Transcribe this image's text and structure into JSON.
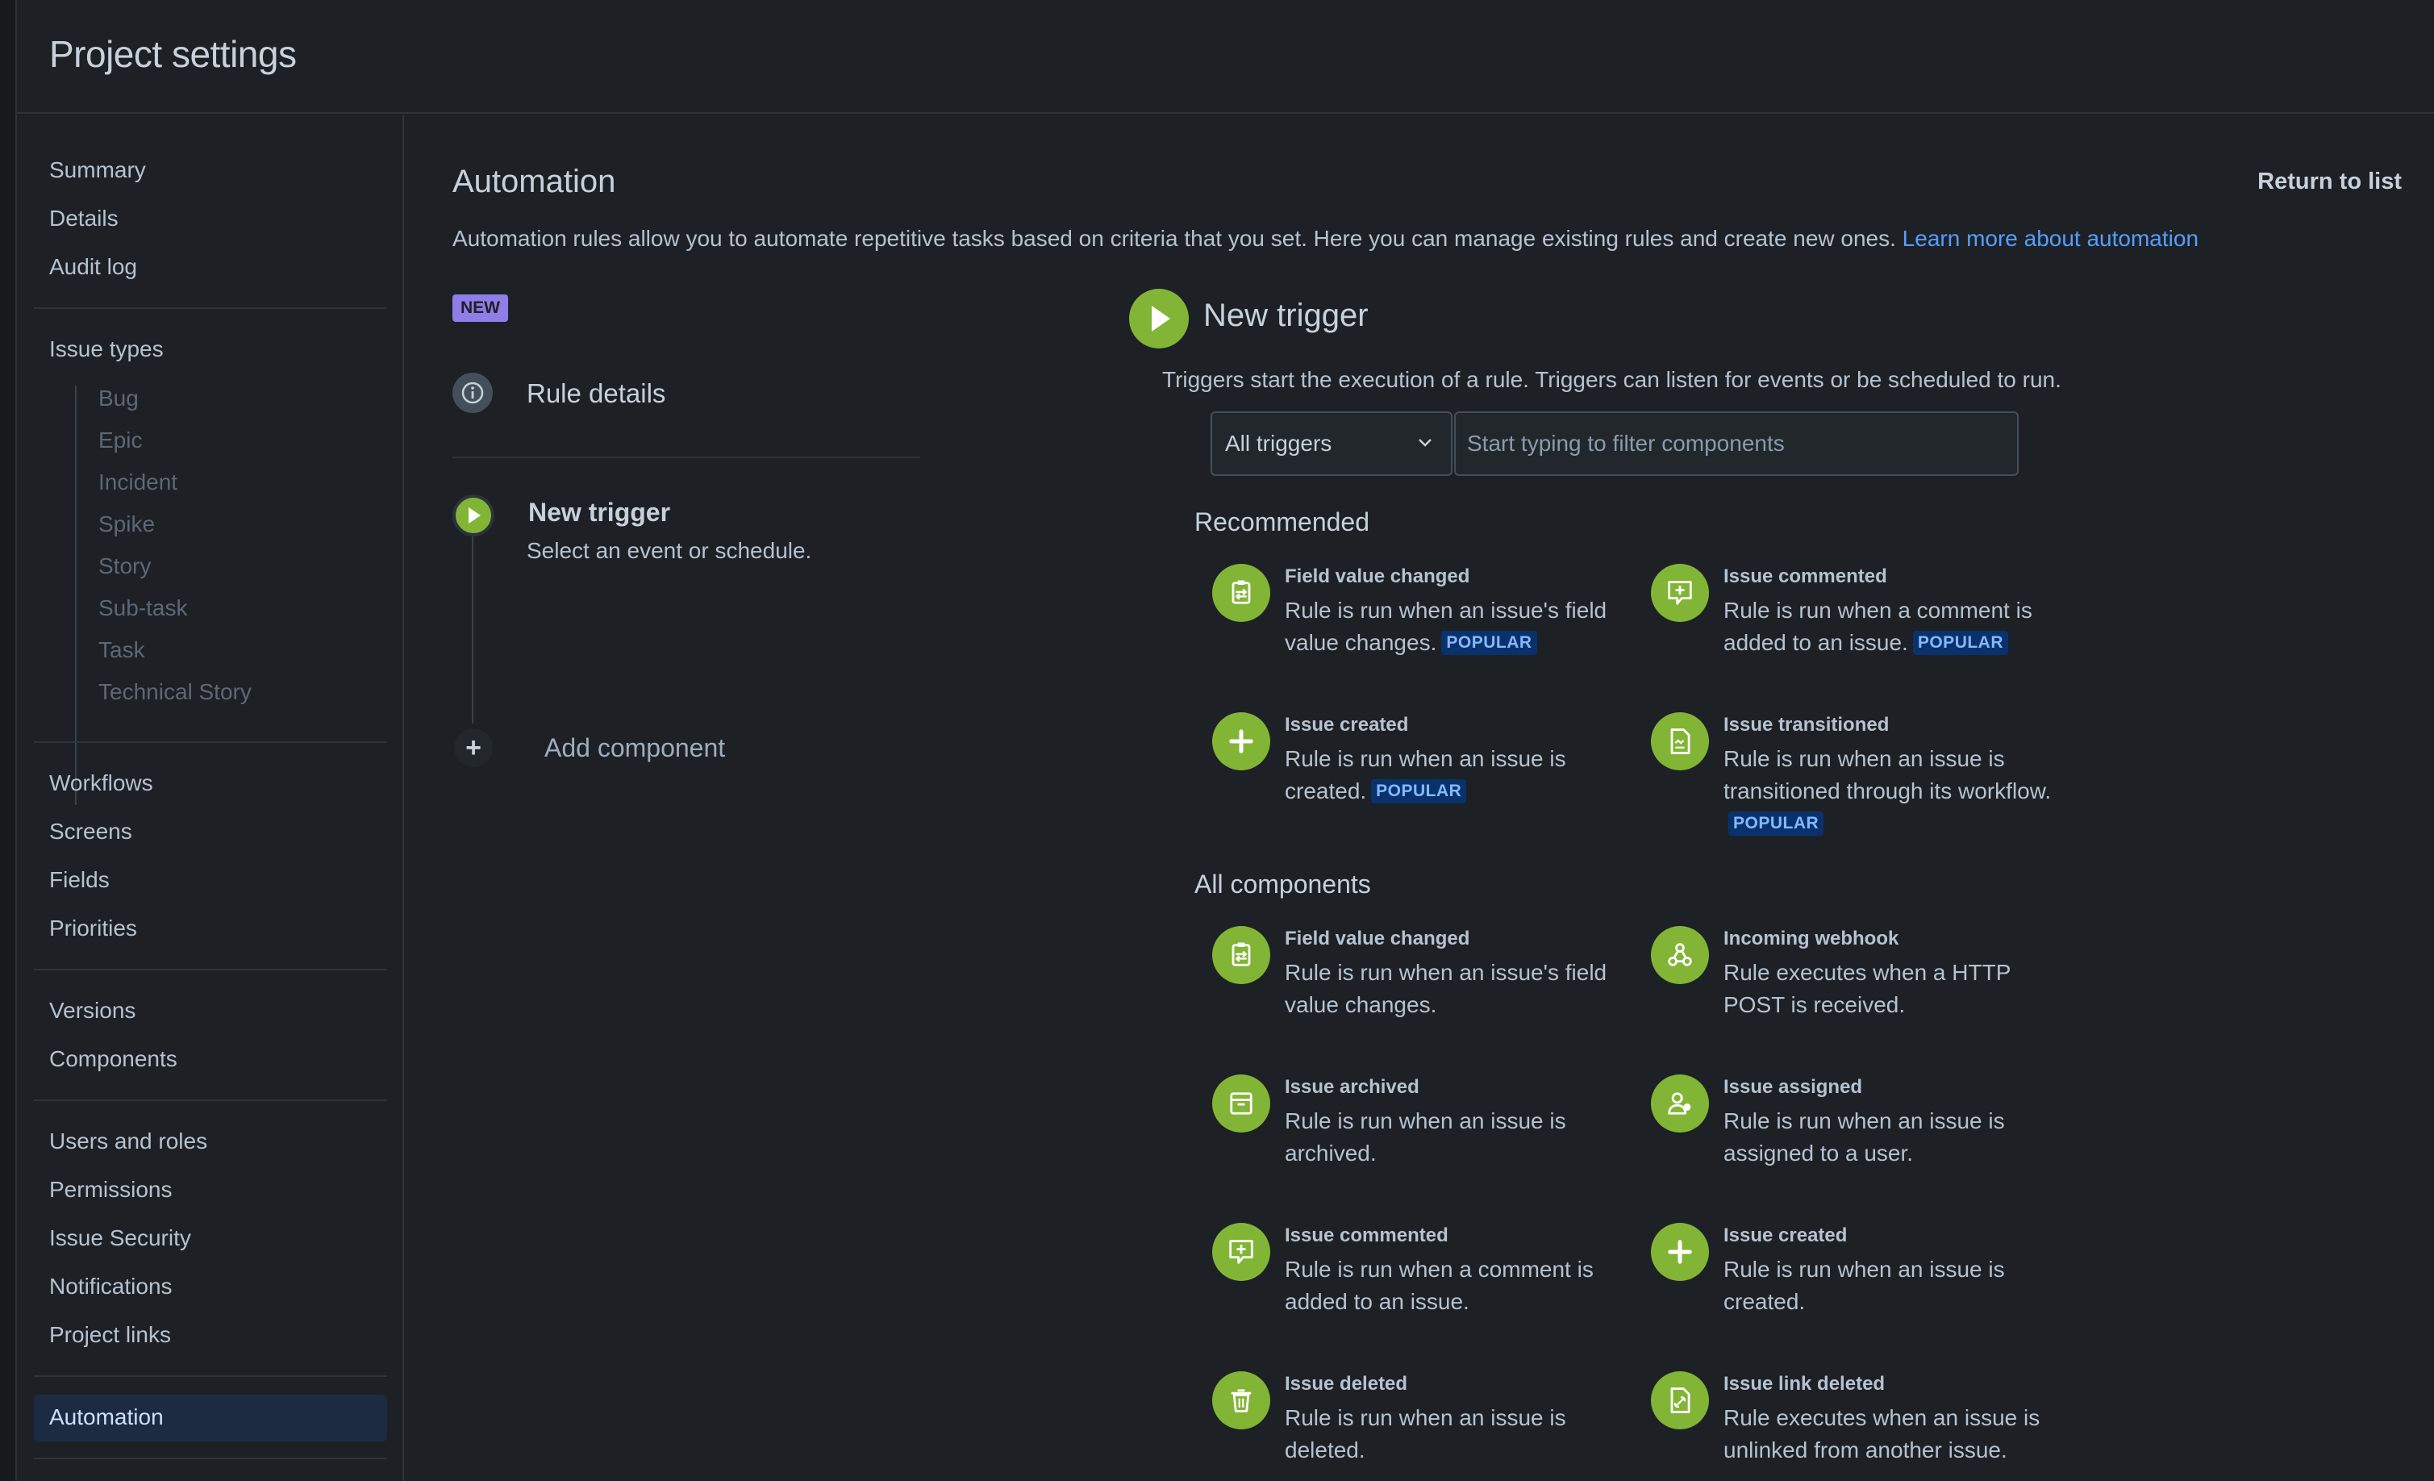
{
  "header": {
    "title": "Project settings"
  },
  "sidebar": {
    "group1": [
      "Summary",
      "Details",
      "Audit log"
    ],
    "issue_types": {
      "label": "Issue types",
      "items": [
        "Bug",
        "Epic",
        "Incident",
        "Spike",
        "Story",
        "Sub-task",
        "Task",
        "Technical Story"
      ]
    },
    "group3": [
      "Workflows",
      "Screens",
      "Fields",
      "Priorities"
    ],
    "group4": [
      "Versions",
      "Components"
    ],
    "group5": [
      "Users and roles",
      "Permissions",
      "Issue Security",
      "Notifications",
      "Project links"
    ],
    "active": "Automation"
  },
  "main": {
    "title": "Automation",
    "return_link": "Return to list",
    "description": "Automation rules allow you to automate repetitive tasks based on criteria that you set. Here you can manage existing rules and create new ones.",
    "learn_more": "Learn more about automation",
    "badge": "NEW",
    "rule_details": "Rule details",
    "flow_trigger_title": "New trigger",
    "flow_trigger_sub": "Select an event or schedule.",
    "add_component": "Add component",
    "add_symbol": "+"
  },
  "trigger_panel": {
    "title": "New trigger",
    "description": "Triggers start the execution of a rule. Triggers can listen for events or be scheduled to run.",
    "select_value": "All triggers",
    "filter_placeholder": "Start typing to filter components",
    "popular_label": "POPULAR",
    "recommended_title": "Recommended",
    "recommended": [
      {
        "title": "Field value changed",
        "desc": "Rule is run when an issue's field value changes.",
        "popular": true,
        "icon": "field-value-icon"
      },
      {
        "title": "Issue commented",
        "desc": "Rule is run when a comment is added to an issue.",
        "popular": true,
        "icon": "comment-icon"
      },
      {
        "title": "Issue created",
        "desc": "Rule is run when an issue is created.",
        "popular": true,
        "icon": "plus-icon"
      },
      {
        "title": "Issue transitioned",
        "desc": "Rule is run when an issue is transitioned through its workflow.",
        "popular": true,
        "icon": "transition-icon"
      }
    ],
    "all_title": "All components",
    "all": [
      {
        "title": "Field value changed",
        "desc": "Rule is run when an issue's field value changes.",
        "icon": "field-value-icon"
      },
      {
        "title": "Incoming webhook",
        "desc": "Rule executes when a HTTP POST is received.",
        "icon": "webhook-icon"
      },
      {
        "title": "Issue archived",
        "desc": "Rule is run when an issue is archived.",
        "icon": "archive-icon"
      },
      {
        "title": "Issue assigned",
        "desc": "Rule is run when an issue is assigned to a user.",
        "icon": "assign-icon"
      },
      {
        "title": "Issue commented",
        "desc": "Rule is run when a comment is added to an issue.",
        "icon": "comment-icon"
      },
      {
        "title": "Issue created",
        "desc": "Rule is run when an issue is created.",
        "icon": "plus-icon"
      },
      {
        "title": "Issue deleted",
        "desc": "Rule is run when an issue is deleted.",
        "icon": "trash-icon"
      },
      {
        "title": "Issue link deleted",
        "desc": "Rule executes when an issue is unlinked from another issue.",
        "icon": "link-deleted-icon"
      }
    ]
  },
  "colors": {
    "accent_green": "#82b536",
    "link_blue": "#579dff",
    "badge_purple": "#8f7ee7",
    "popular_bg": "#09326c"
  }
}
